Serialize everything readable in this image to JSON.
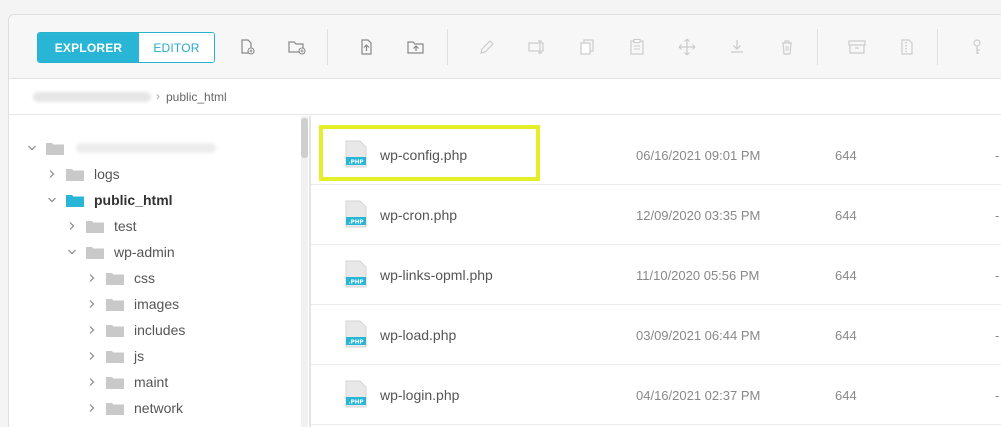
{
  "toolbar": {
    "explorer_label": "EXPLORER",
    "editor_label": "EDITOR",
    "icons": [
      "new-file-icon",
      "new-folder-icon",
      "upload-file-icon",
      "upload-folder-icon",
      "edit-icon",
      "rename-icon",
      "copy-icon",
      "paste-icon",
      "move-icon",
      "download-icon",
      "delete-icon",
      "archive-icon",
      "extract-icon",
      "permissions-icon"
    ]
  },
  "breadcrumb": {
    "separator": "›",
    "current": "public_html"
  },
  "tree": {
    "items": [
      {
        "label": "logs"
      },
      {
        "label": "public_html"
      },
      {
        "label": "test"
      },
      {
        "label": "wp-admin"
      },
      {
        "label": "css"
      },
      {
        "label": "images"
      },
      {
        "label": "includes"
      },
      {
        "label": "js"
      },
      {
        "label": "maint"
      },
      {
        "label": "network"
      }
    ]
  },
  "files": [
    {
      "name": "wp-config.php",
      "date": "06/16/2021 09:01 PM",
      "perms": "644",
      "extra": "-",
      "highlighted": true
    },
    {
      "name": "wp-cron.php",
      "date": "12/09/2020 03:35 PM",
      "perms": "644",
      "extra": "-"
    },
    {
      "name": "wp-links-opml.php",
      "date": "11/10/2020 05:56 PM",
      "perms": "644",
      "extra": "-"
    },
    {
      "name": "wp-load.php",
      "date": "03/09/2021 06:44 PM",
      "perms": "644",
      "extra": "-"
    },
    {
      "name": "wp-login.php",
      "date": "04/16/2021 02:37 PM",
      "perms": "644",
      "extra": "-"
    }
  ],
  "file_icon_label": ".PHP",
  "colors": {
    "accent": "#29b6d6",
    "highlight": "#e4ef2a",
    "folder": "#c9c9c9",
    "folder_active": "#29b6d6"
  }
}
